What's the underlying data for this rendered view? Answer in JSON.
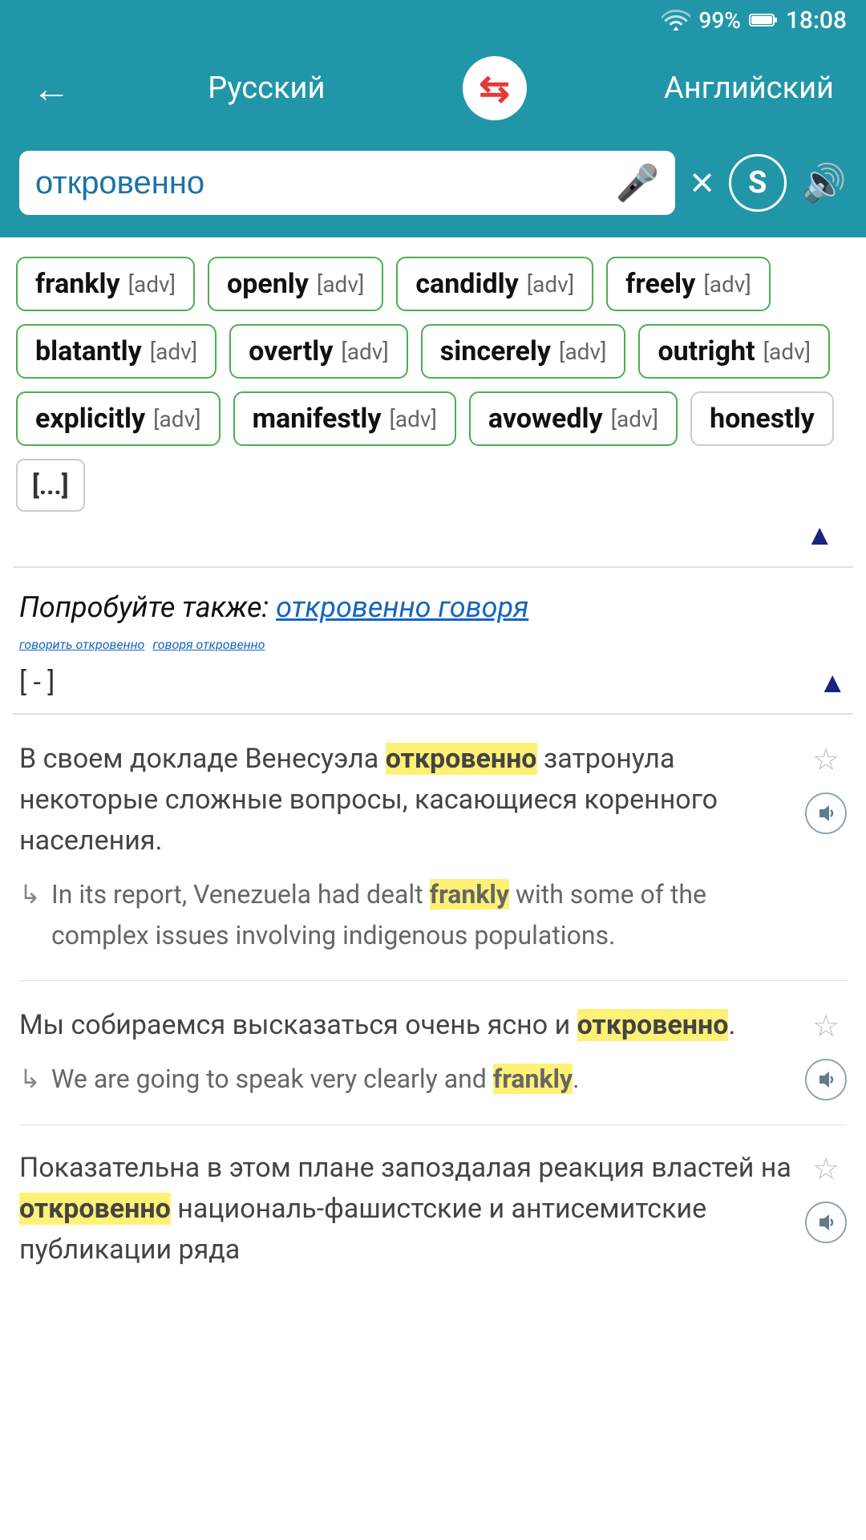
{
  "status": {
    "wifi": "wifi",
    "signal": "signal",
    "battery": "99%",
    "charging": true,
    "time": "18:08"
  },
  "header": {
    "back_label": "←",
    "lang_from": "Русский",
    "lang_to": "Английский",
    "swap_icon": "⇄"
  },
  "search": {
    "query": "откровенно",
    "mic_placeholder": "mic",
    "clear_label": "×",
    "s_label": "S",
    "sound_label": "🔊"
  },
  "translations": [
    {
      "word": "frankly",
      "pos": "[adv]"
    },
    {
      "word": "openly",
      "pos": "[adv]"
    },
    {
      "word": "candidly",
      "pos": "[adv]"
    },
    {
      "word": "freely",
      "pos": "[adv]"
    },
    {
      "word": "blatantly",
      "pos": "[adv]"
    },
    {
      "word": "overtly",
      "pos": "[adv]"
    },
    {
      "word": "sincerely",
      "pos": "[adv]"
    },
    {
      "word": "outright",
      "pos": "[adv]"
    },
    {
      "word": "explicitly",
      "pos": "[adv]"
    },
    {
      "word": "manifestly",
      "pos": "[adv]"
    },
    {
      "word": "avowedly",
      "pos": "[adv]"
    },
    {
      "word": "honestly",
      "pos": ""
    }
  ],
  "expand_btn": "[...]",
  "try_also": {
    "label": "Попробуйте также:",
    "links": [
      "откровенно говоря",
      "говорить откровенно",
      "говоря откровенно"
    ],
    "bracket_label": "[ - ]"
  },
  "examples": [
    {
      "ru_text": "В своем докладе Венесуэла ",
      "ru_highlight": "откровенно",
      "ru_rest": " затронула некоторые сложные вопросы, касающиеся коренного населения.",
      "en_text": "In its report, Venezuela had dealt ",
      "en_highlight": "frankly",
      "en_rest": " with some of the complex issues involving indigenous populations."
    },
    {
      "ru_text": "Мы собираемся высказаться очень ясно и ",
      "ru_highlight": "откровенно",
      "ru_rest": ".",
      "en_text": "We are going to speak very clearly and ",
      "en_highlight": "frankly",
      "en_rest": "."
    }
  ],
  "partial_example": {
    "ru_text": "Показательна в этом плане запоздалая реакция властей на ",
    "ru_highlight": "откровенно",
    "ru_rest": " националь-фашистские и антисемитские публикации ряда"
  }
}
